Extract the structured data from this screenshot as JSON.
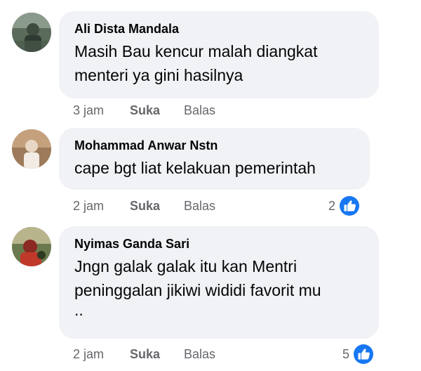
{
  "comments": [
    {
      "author": "Ali Dista Mandala",
      "lines": [
        "Masih Bau kencur malah diangkat",
        "menteri ya gini hasilnya"
      ],
      "time": "3 jam",
      "like_label": "Suka",
      "reply_label": "Balas",
      "reaction_count": null,
      "avatar_icon": "avatar-photo"
    },
    {
      "author": "Mohammad Anwar Nstn",
      "lines": [
        "cape bgt liat kelakuan pemerintah"
      ],
      "time": "2 jam",
      "like_label": "Suka",
      "reply_label": "Balas",
      "reaction_count": "2",
      "avatar_icon": "avatar-photo"
    },
    {
      "author": "Nyimas Ganda Sari",
      "lines": [
        "Jngn galak galak itu kan Mentri",
        "peninggalan jikiwi wididi favorit mu",
        ".."
      ],
      "time": "2 jam",
      "like_label": "Suka",
      "reply_label": "Balas",
      "reaction_count": "5",
      "avatar_icon": "avatar-photo"
    }
  ],
  "colors": {
    "bubble": "#f0f2f5",
    "text": "#050505",
    "meta": "#65676b",
    "like_blue": "#1877f2"
  }
}
